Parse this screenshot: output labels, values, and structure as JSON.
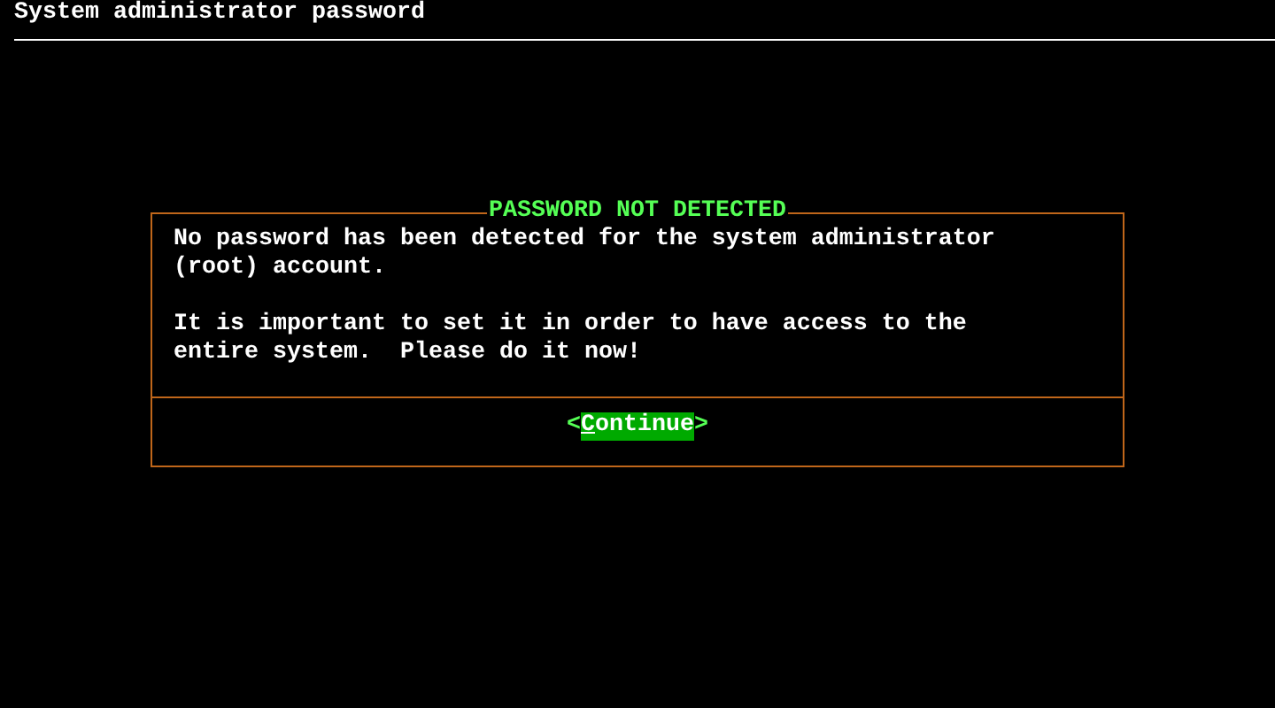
{
  "header": {
    "title": "System administrator password"
  },
  "dialog": {
    "title": "PASSWORD NOT DETECTED",
    "paragraphs": [
      "No password has been detected for the system administrator (root) account.",
      "It is important to set it in order to have access to the entire system.  Please do it now!"
    ],
    "buttons": [
      {
        "open": "<",
        "label": "Continue",
        "close": ">",
        "selected": true
      }
    ]
  }
}
